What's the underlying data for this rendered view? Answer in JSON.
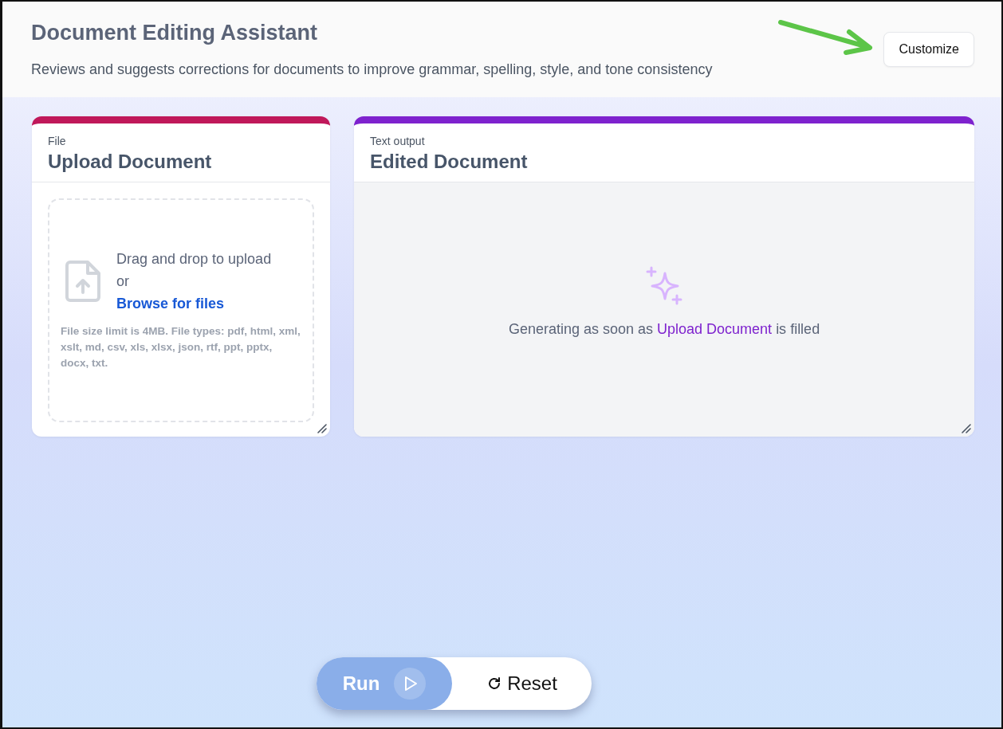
{
  "header": {
    "title": "Document Editing Assistant",
    "subtitle": "Reviews and suggests corrections for documents to improve grammar, spelling, style, and tone consistency",
    "customize_button": "Customize"
  },
  "cards": [
    {
      "kind": "file",
      "type_label": "File",
      "title": "Upload Document",
      "color": "#c0185a",
      "drop_text": "Drag and drop to upload",
      "or_text": "or",
      "browse_link": "Browse for files",
      "limits": "File size limit is 4MB. File types: pdf, html, xml, xslt, md, csv, xls, xlsx, json, rtf, ppt, pptx, docx, txt."
    },
    {
      "kind": "output",
      "type_label": "Text output",
      "title": "Edited Document",
      "color": "#7e22ce",
      "message_before": "Generating as soon as",
      "message_link": "Upload Document",
      "message_after": "is filled"
    }
  ],
  "actions": {
    "run": {
      "label": "Run",
      "disabled": true
    },
    "reset": {
      "label": "Reset"
    }
  }
}
